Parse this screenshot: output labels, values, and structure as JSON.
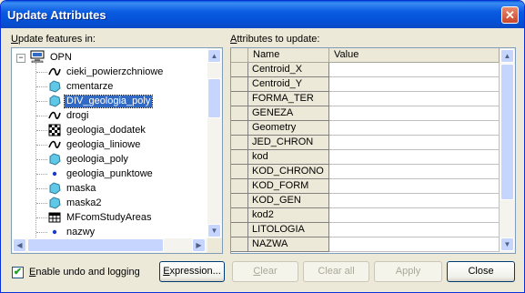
{
  "window": {
    "title": "Update Attributes",
    "close_glyph": "✕"
  },
  "left": {
    "label_prefix": "",
    "label_u": "U",
    "label_rest": "pdate features in:",
    "root": "OPN",
    "items": [
      {
        "label": "cieki_powierzchniowe",
        "icon": "line-layer-icon"
      },
      {
        "label": "cmentarze",
        "icon": "polygon-layer-icon"
      },
      {
        "label": "DIV_geologia_poly",
        "icon": "polygon-layer-icon",
        "selected": true
      },
      {
        "label": "drogi",
        "icon": "line-layer-icon"
      },
      {
        "label": "geologia_dodatek",
        "icon": "raster-layer-icon"
      },
      {
        "label": "geologia_liniowe",
        "icon": "line-layer-icon"
      },
      {
        "label": "geologia_poly",
        "icon": "polygon-layer-icon"
      },
      {
        "label": "geologia_punktowe",
        "icon": "point-layer-icon"
      },
      {
        "label": "maska",
        "icon": "polygon-layer-icon"
      },
      {
        "label": "maska2",
        "icon": "polygon-layer-icon"
      },
      {
        "label": "MFcomStudyAreas",
        "icon": "table-icon"
      },
      {
        "label": "nazwy",
        "icon": "point-layer-icon"
      }
    ]
  },
  "right": {
    "label_prefix": "",
    "label_u": "A",
    "label_rest": "ttributes to update:",
    "col_name": "Name",
    "col_value": "Value",
    "rows": [
      {
        "name": "Centroid_X",
        "value": ""
      },
      {
        "name": "Centroid_Y",
        "value": ""
      },
      {
        "name": "FORMA_TER",
        "value": ""
      },
      {
        "name": "GENEZA",
        "value": ""
      },
      {
        "name": "Geometry",
        "value": ""
      },
      {
        "name": "JED_CHRON",
        "value": ""
      },
      {
        "name": "kod",
        "value": ""
      },
      {
        "name": "KOD_CHRONO",
        "value": ""
      },
      {
        "name": "KOD_FORM",
        "value": ""
      },
      {
        "name": "KOD_GEN",
        "value": ""
      },
      {
        "name": "kod2",
        "value": ""
      },
      {
        "name": "LITOLOGIA",
        "value": ""
      },
      {
        "name": "NAZWA",
        "value": ""
      }
    ]
  },
  "footer": {
    "checkbox_checked": true,
    "checkbox_u": "E",
    "checkbox_rest": "nable undo and logging",
    "expression_u": "E",
    "expression_rest": "xpression...",
    "clear_u": "C",
    "clear_rest": "lear",
    "clear_all": "Clear all",
    "apply": "Apply",
    "close": "Close"
  }
}
